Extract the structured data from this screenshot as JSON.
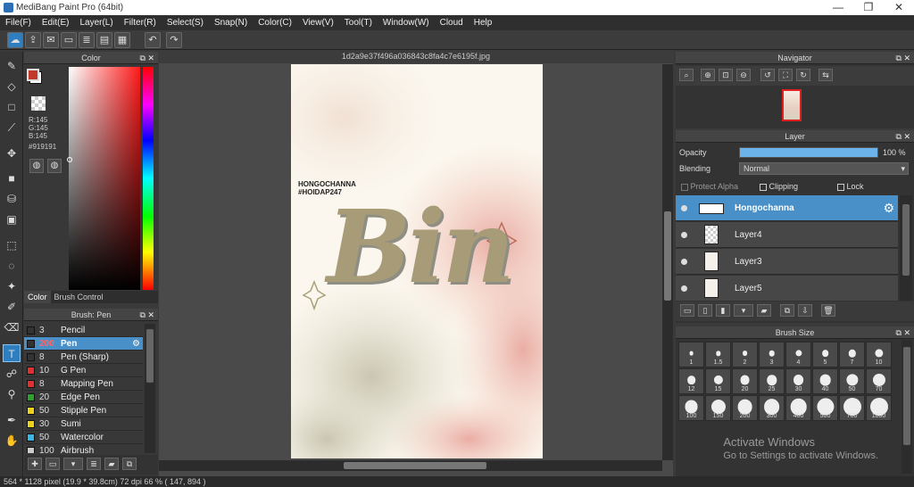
{
  "app": {
    "title": "MediBang Paint Pro (64bit)"
  },
  "menu": [
    "File(F)",
    "Edit(E)",
    "Layer(L)",
    "Filter(R)",
    "Select(S)",
    "Snap(N)",
    "Color(C)",
    "View(V)",
    "Tool(T)",
    "Window(W)",
    "Cloud",
    "Help"
  ],
  "color_panel": {
    "title": "Color",
    "r": "R:145",
    "g": "G:145",
    "b": "B:145",
    "hex": "#919191",
    "tab_color": "Color",
    "tab_brush_control": "Brush Control",
    "fg": "#c0392b",
    "bg": "#ffffff"
  },
  "brush_panel": {
    "title": "Brush: Pen",
    "items": [
      {
        "size": "3",
        "name": "Pencil",
        "color": "#333333"
      },
      {
        "size": "200",
        "name": "Pen",
        "color": "#333333"
      },
      {
        "size": "8",
        "name": "Pen (Sharp)",
        "color": "#333333"
      },
      {
        "size": "10",
        "name": "G Pen",
        "color": "#e03030"
      },
      {
        "size": "8",
        "name": "Mapping Pen",
        "color": "#e03030"
      },
      {
        "size": "20",
        "name": "Edge Pen",
        "color": "#2ca02c"
      },
      {
        "size": "50",
        "name": "Stipple Pen",
        "color": "#e8d21a"
      },
      {
        "size": "30",
        "name": "Sumi",
        "color": "#e8d21a"
      },
      {
        "size": "50",
        "name": "Watercolor",
        "color": "#39b6e8"
      },
      {
        "size": "100",
        "name": "Airbrush",
        "color": "#cccccc"
      }
    ]
  },
  "document": {
    "tab_title": "1d2a9e37f496a036843c8fa4c7e6195f.jpg",
    "credit_line1": "HONGOCHANNA",
    "credit_line2": "#HOIDAP247",
    "art_text": "Bin"
  },
  "navigator": {
    "title": "Navigator"
  },
  "layer_panel": {
    "title": "Layer",
    "opacity_label": "Opacity",
    "opacity_value": "100 %",
    "opacity_fraction": 1.0,
    "blending_label": "Blending",
    "blending_value": "Normal",
    "protect_alpha": "Protect Alpha",
    "clipping": "Clipping",
    "lock": "Lock",
    "layers": [
      "Hongochanna",
      "Layer4",
      "Layer3",
      "Layer5"
    ]
  },
  "brush_size": {
    "title": "Brush Size",
    "sizes": [
      "1",
      "1.5",
      "2",
      "3",
      "4",
      "5",
      "7",
      "10",
      "12",
      "15",
      "20",
      "25",
      "30",
      "40",
      "50",
      "70",
      "100",
      "150",
      "200",
      "300",
      "400",
      "500",
      "700",
      "1000"
    ]
  },
  "status": {
    "text": "564 * 1128 pixel  (19.9 * 39.8cm)  72 dpi  66 %  ( 147, 894 )"
  },
  "watermark": {
    "line1": "Activate Windows",
    "line2": "Go to Settings to activate Windows."
  }
}
